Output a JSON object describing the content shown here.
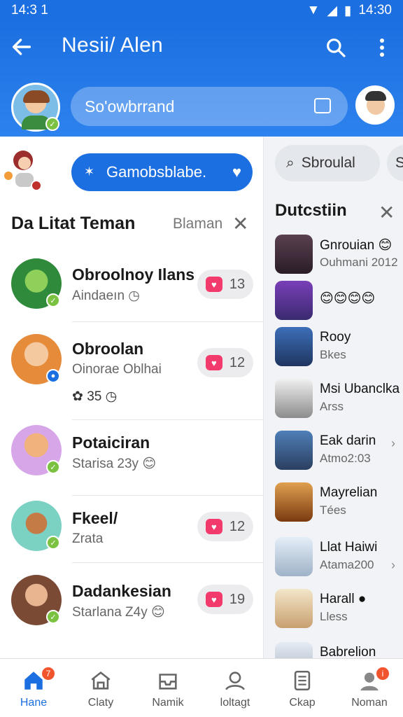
{
  "status_bar": {
    "time_left": "14:3 1",
    "time_right": "14:30"
  },
  "header": {
    "title": "Nesii/ Alen",
    "search_placeholder": "So'owbrrand"
  },
  "left": {
    "pill_label": "Gamobsblabe.",
    "section_title": "Da Litat Teman",
    "section_sub": "Blaman",
    "rows": [
      {
        "name": "Obroolnoy Ilans",
        "sub": "Aindaeın",
        "count": "13",
        "avatar_color": "#2f8a3b"
      },
      {
        "name": "Obroolan",
        "sub": "Oinorae Oblhai",
        "extra": "35",
        "count": "12",
        "avatar_color": "#e58b3a"
      },
      {
        "name": "Potaiciran",
        "sub": "Starisa 23y",
        "count": "",
        "avatar_color": "#d6a6e8"
      },
      {
        "name": "Fkeel/",
        "sub": "Zrata",
        "count": "12",
        "avatar_color": "#7bd1c2"
      },
      {
        "name": "Dadankesian",
        "sub": "Starlana Z4y",
        "count": "19",
        "avatar_color": "#7a4a35"
      }
    ]
  },
  "right": {
    "search_label": "Sbroulal",
    "search_label_2": "S",
    "title": "Dutcstiin",
    "items": [
      {
        "name": "Gnrouian",
        "sub": "Ouhmani 2012",
        "color": "#3b2a3a"
      },
      {
        "name": "",
        "sub": "",
        "emojis": "😊😊😊😊",
        "color": "#5a2a8a"
      },
      {
        "name": "Rooy",
        "sub": "Bkes",
        "color": "#2b4a7a"
      },
      {
        "name": "Msi Ubanclka",
        "sub": "Arss",
        "color": "#e6e6e6"
      },
      {
        "name": "Eak darin",
        "sub": "Atmo2:03",
        "color": "#3b5b8a"
      },
      {
        "name": "Mayrelian",
        "sub": "Tées",
        "color": "#b86a2a"
      },
      {
        "name": "Llat Haiwi",
        "sub": "Atama200",
        "color": "#c8d8e8"
      },
      {
        "name": "Harall",
        "sub": "Lless",
        "color": "#e8d5b0"
      },
      {
        "name": "Babrelion",
        "sub": "",
        "color": "#c0c8d8"
      }
    ]
  },
  "nav": [
    {
      "label": "Hane",
      "icon": "home-icon",
      "badge": "7"
    },
    {
      "label": "Claty",
      "icon": "house-outline-icon"
    },
    {
      "label": "Namik",
      "icon": "inbox-icon"
    },
    {
      "label": "loltagt",
      "icon": "person-icon"
    },
    {
      "label": "Ckap",
      "icon": "document-icon"
    },
    {
      "label": "Noman",
      "icon": "profile-icon",
      "badge": "i"
    }
  ],
  "colors": {
    "primary": "#1c6fe0",
    "accent_pink": "#f23a6d",
    "online_green": "#7cc242"
  }
}
